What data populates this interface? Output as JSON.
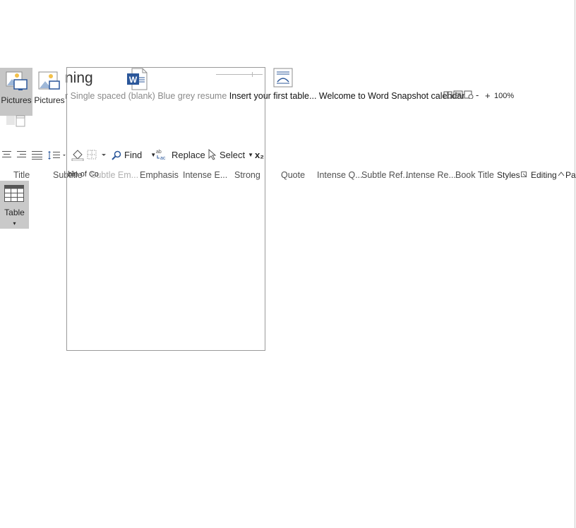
{
  "ribbon": {
    "pictures_buttons": [
      {
        "label": "Pictures",
        "selected": true
      },
      {
        "label": "Pictures",
        "selected": false
      }
    ],
    "heading_fragment": "ning",
    "template_row": {
      "faded_text": "r Single spaced (blank) Blue grey resume",
      "text": "Insert your first table... Welcome to Word Snapshot calendar"
    },
    "zoom": {
      "minus": "-",
      "plus": "+",
      "level": "100%"
    },
    "editing_tools": {
      "find": "Find",
      "replace": "Replace",
      "select": "Select",
      "subscript": "x₂"
    },
    "styles": [
      "Title",
      "Subtitle",
      "Subtle Em...",
      "Emphasis",
      "Intense E...",
      "Strong",
      "Quote",
      "Intense Q...",
      "Subtle Ref...",
      "Intense Re...",
      "Book Title"
    ],
    "styles_overlap_text": "ble of Co",
    "styles_group_label": "Styles",
    "editing_group_label": "Editing",
    "page_tab_fragment": "Pa",
    "table_button": "Table"
  },
  "colors": {
    "selected_bg": "#c6c6c6",
    "word_blue": "#2b579a",
    "panel_border": "#9a9a9a"
  },
  "icons": [
    "picture-icon",
    "word-document-icon",
    "page-layout-icon",
    "table-grid-icon",
    "find-icon",
    "replace-icon",
    "select-cursor-icon",
    "shading-icon",
    "borders-icon",
    "line-spacing-icon",
    "align-center-icon",
    "align-right-icon",
    "justify-icon",
    "read-mode-icon",
    "print-layout-icon",
    "web-layout-icon",
    "dialog-launcher-icon",
    "collapse-ribbon-icon"
  ]
}
